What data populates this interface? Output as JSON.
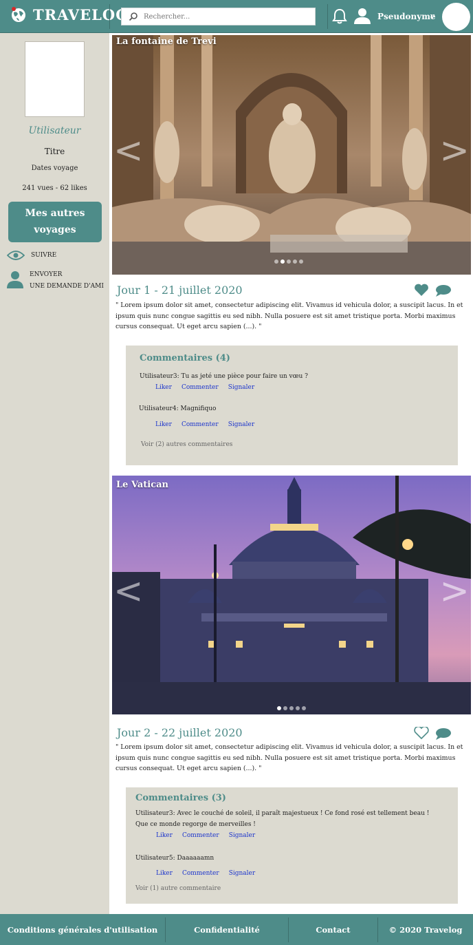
{
  "header": {
    "brand": "TRAVELOG",
    "search_placeholder": "Rechercher...",
    "username": "Pseudonyme",
    "chevron": "v",
    "colors": {
      "primary": "#4e8c89",
      "sidebar": "#dcdad0"
    }
  },
  "sidebar": {
    "user_label": "Utilisateur",
    "title": "Titre",
    "dates": "Dates voyage",
    "stats": "241 vues - 62 likes",
    "other_trips_line1": "Mes autres",
    "other_trips_line2": "voyages",
    "follow": "SUIVRE",
    "friend_line1": "ENVOYER",
    "friend_line2": "UNE DEMANDE D'AMI"
  },
  "posts": [
    {
      "caption": "La fontaine de Trevi",
      "day": "Jour 1 - 21 juillet 2020",
      "liked": true,
      "text": "\" Lorem ipsum dolor sit amet, consectetur adipiscing elit. Vivamus id vehicula dolor, a suscipit lacus. In et ipsum quis nunc congue sagittis eu sed nibh. Nulla posuere est sit amet tristique porta. Morbi maximus cursus consequat. Ut eget arcu sapien (...). \"",
      "comments_title": "Commentaires (4)",
      "comments": [
        {
          "text": "Utilisateur3: Tu as jeté une pièce pour faire un vœu ?"
        },
        {
          "text": "Utilisateur4: Magnifiquo"
        }
      ],
      "more": "Voir (2) autres commentaires"
    },
    {
      "caption": "Le Vatican",
      "day": "Jour 2 - 22 juillet 2020",
      "liked": false,
      "text": "\" Lorem ipsum dolor sit amet, consectetur adipiscing elit. Vivamus id vehicula dolor, a suscipit lacus. In et ipsum quis nunc congue sagittis eu sed nibh. Nulla posuere est sit amet tristique porta. Morbi maximus cursus consequat. Ut eget arcu sapien (...). \"",
      "comments_title": "Commentaires (3)",
      "comments": [
        {
          "text": "Utilisateur3: Avec le couché de soleil, il paraît majestueux ! Ce fond rosé est tellement beau ! Que ce monde regorge de merveilles !"
        },
        {
          "text": "Utilisateur5: Daaaaaamn"
        }
      ],
      "more": "Voir (1) autre commentaire"
    }
  ],
  "comment_actions": {
    "like": "Liker",
    "comment": "Commenter",
    "report": "Signaler"
  },
  "footer": {
    "terms": "Conditions générales d'utilisation",
    "privacy": "Confidentialité",
    "contact": "Contact",
    "copyright": "©  2020 Travelog"
  }
}
